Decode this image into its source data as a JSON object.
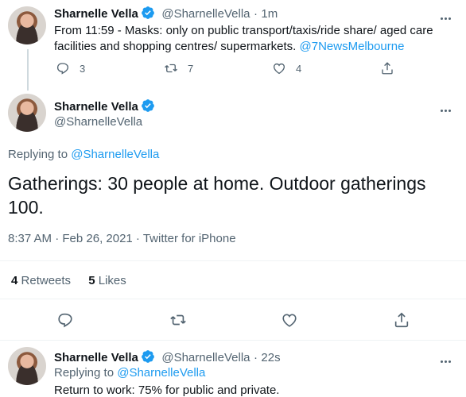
{
  "tweet1": {
    "name": "Sharnelle Vella",
    "handle": "@SharnelleVella",
    "sep": "·",
    "time": "1m",
    "text_line1": "From 11:59 - Masks: only on public transport/taxis/ride share/ aged care",
    "text_line2_plain": "facilities and shopping centres/ supermarkets.",
    "mention": "@7NewsMelbourne",
    "replies": "3",
    "retweets": "7",
    "likes": "4"
  },
  "main_tweet": {
    "name": "Sharnelle Vella",
    "handle": "@SharnelleVella",
    "replying_label": "Replying to",
    "replying_to": "@SharnelleVella",
    "text_line1": "Gatherings: 30 people at home. Outdoor gatherings",
    "text_line2": "100.",
    "timestamp": "8:37 AM · Feb 26, 2021 · Twitter for iPhone",
    "retweets_count": "4",
    "retweets_label": "Retweets",
    "likes_count": "5",
    "likes_label": "Likes"
  },
  "tweet3": {
    "name": "Sharnelle Vella",
    "handle": "@SharnelleVella",
    "sep": "·",
    "time": "22s",
    "replying_label": "Replying to",
    "replying_to": "@SharnelleVella",
    "text": "Return to work: 75% for public and private."
  },
  "colors": {
    "accent": "#1d9bf0",
    "muted": "#536471",
    "text": "#0f1419"
  }
}
